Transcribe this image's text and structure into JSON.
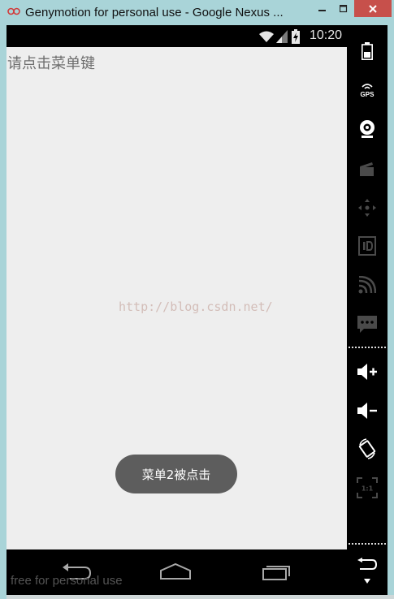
{
  "window": {
    "title": "Genymotion for personal use - Google Nexus ...",
    "minimize_icon": "minimize-icon",
    "maximize_icon": "maximize-icon",
    "close_icon": "close-icon",
    "close_color": "#c7504b"
  },
  "statusbar": {
    "time": "10:20",
    "icons": [
      "wifi-icon",
      "signal-icon",
      "battery-charging-icon"
    ]
  },
  "app": {
    "hint_text": "请点击菜单键",
    "watermark": "http://blog.csdn.net/",
    "toast": "菜单2被点击",
    "background_color": "#eeeeee",
    "toast_color": "#5d5d5d"
  },
  "navbar": {
    "buttons": [
      "back-icon",
      "home-icon",
      "recent-apps-icon"
    ],
    "footer_text": "free for personal use"
  },
  "sidebar": {
    "tools": [
      "battery-icon",
      "gps-icon",
      "webcam-icon",
      "video-capture-icon",
      "dpad-icon",
      "device-id-icon",
      "cast-icon",
      "sms-icon",
      "volume-up-icon",
      "volume-down-icon",
      "rotate-icon",
      "pixel-perfect-icon",
      "back-icon",
      "scroll-down-icon"
    ],
    "gps_label": "GPS",
    "pixel_label": "1:1"
  }
}
